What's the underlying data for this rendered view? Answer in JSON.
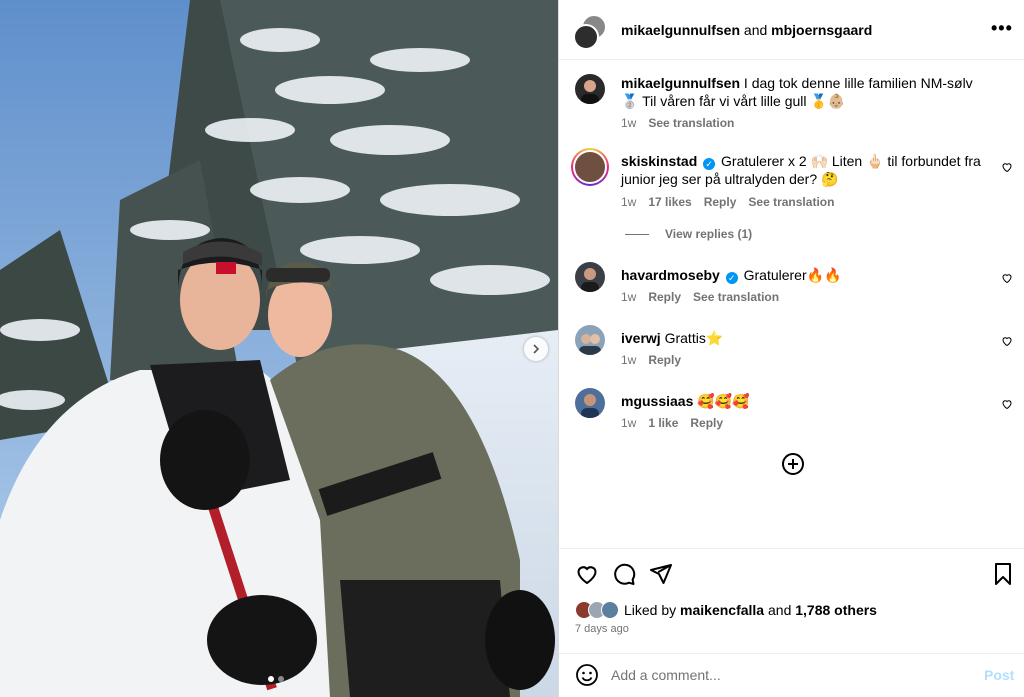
{
  "media": {
    "alt_icons": {
      "next": "chevron-right-icon"
    },
    "carousel": {
      "count": 2,
      "active": 0
    }
  },
  "header": {
    "user1": "mikaelgunnulfsen",
    "joiner": " and ",
    "user2": "mbjoernsgaard",
    "more_icon": "more-icon",
    "more_label": "•••"
  },
  "caption": {
    "username": "mikaelgunnulfsen",
    "text": "I dag tok denne lille familien NM-sølv 🥈 Til våren får vi vårt lille gull 🥇👶🏼",
    "time": "1w",
    "see_translation": "See translation"
  },
  "comments": [
    {
      "username": "skiskinstad",
      "verified": true,
      "text": "Gratulerer x 2 🙌🏻 Liten 🖕🏻 til forbundet fra junior jeg ser på ultralyden der? 🤔",
      "time": "1w",
      "likes": "17 likes",
      "reply": "Reply",
      "see_translation": "See translation",
      "view_replies": "View replies (1)"
    },
    {
      "username": "havardmoseby",
      "verified": true,
      "text": "Gratulerer🔥🔥",
      "time": "1w",
      "reply": "Reply",
      "see_translation": "See translation"
    },
    {
      "username": "iverwj",
      "verified": false,
      "text": "Grattis⭐️",
      "time": "1w",
      "reply": "Reply"
    },
    {
      "username": "mgussiaas",
      "verified": false,
      "text": "🥰🥰🥰",
      "time": "1w",
      "likes": "1 like",
      "reply": "Reply"
    }
  ],
  "load_more_icon": "plus-circle-icon",
  "actions": {
    "like_icon": "heart-icon",
    "comment_icon": "comment-icon",
    "share_icon": "share-icon",
    "save_icon": "bookmark-icon"
  },
  "likes": {
    "prefix": "Liked by ",
    "user": "maikencfalla",
    "middle": " and ",
    "others": "1,788 others"
  },
  "date": "7 days ago",
  "add_comment": {
    "emoji_icon": "emoji-icon",
    "placeholder": "Add a comment...",
    "post_label": "Post"
  },
  "colors": {
    "verified": "#0095f6",
    "secondary_text": "#737373",
    "post_disabled": "#b2dffc"
  }
}
